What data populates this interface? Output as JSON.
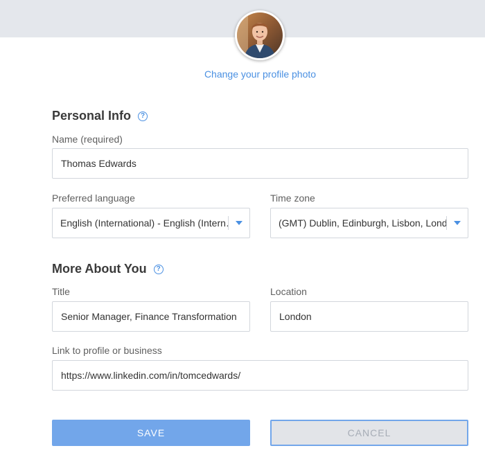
{
  "profile": {
    "change_photo_label": "Change your profile photo"
  },
  "personal_info": {
    "heading": "Personal Info",
    "help_glyph": "?",
    "name_label": "Name (required)",
    "name_value": "Thomas Edwards",
    "language_label": "Preferred language",
    "language_value": "English (International) - English (Intern…",
    "timezone_label": "Time zone",
    "timezone_value": "(GMT) Dublin, Edinburgh, Lisbon, Lond…"
  },
  "more_about": {
    "heading": "More About You",
    "help_glyph": "?",
    "title_label": "Title",
    "title_value": "Senior Manager, Finance Transformation",
    "location_label": "Location",
    "location_value": "London",
    "link_label": "Link to profile or business",
    "link_value": "https://www.linkedin.com/in/tomcedwards/"
  },
  "actions": {
    "save_label": "SAVE",
    "cancel_label": "CANCEL"
  },
  "icons": {
    "help": "help-icon",
    "dropdown": "chevron-down-icon"
  },
  "colors": {
    "accent": "#4a90e2",
    "save_button": "#72a6ea",
    "cancel_button_bg": "#e2e4e8",
    "top_band": "#e4e7ec"
  }
}
